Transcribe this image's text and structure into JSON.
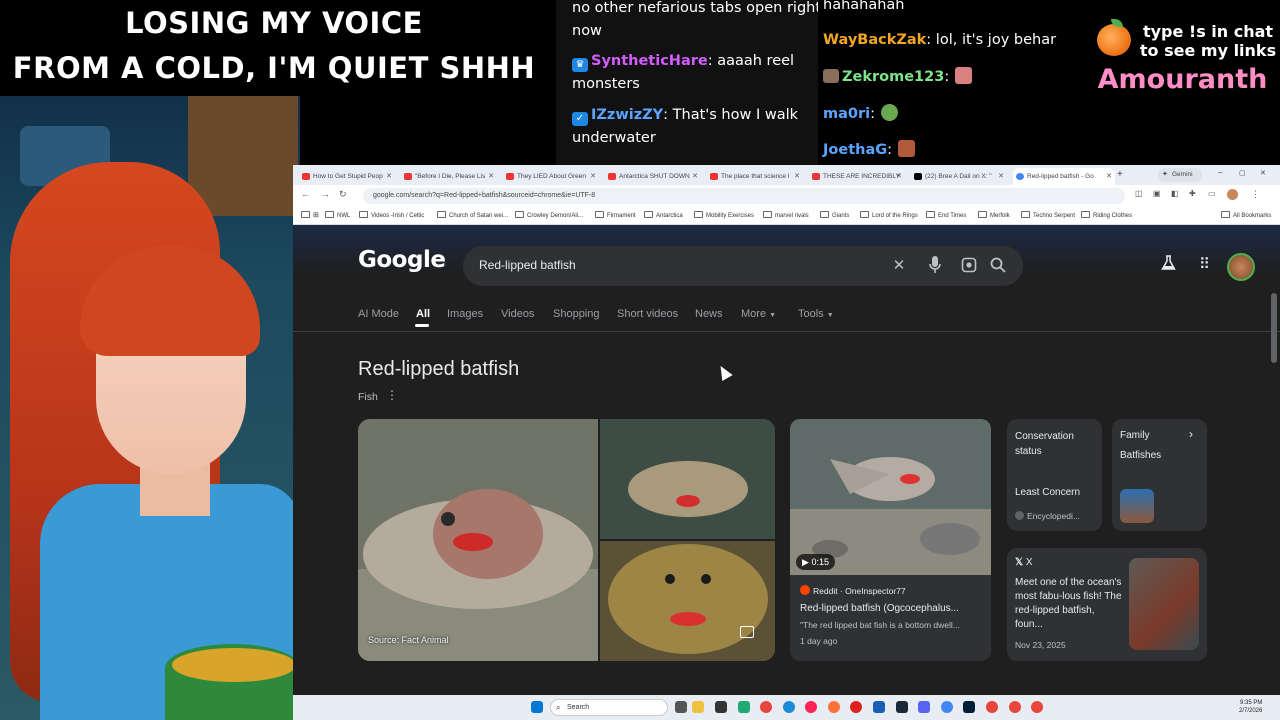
{
  "caption": {
    "line1": "LOSING MY VOICE",
    "line2": "FROM A COLD, I'M QUIET SHHH"
  },
  "chat_left": [
    {
      "user": "",
      "text": "no other nefarious tabs open right"
    },
    {
      "user": "",
      "text": "now"
    },
    {
      "user": "SyntheticHare",
      "user_color": "#d15dff",
      "text": ": aaaah reel"
    },
    {
      "user": "",
      "text": "monsters"
    },
    {
      "user": "IZzwizZY",
      "user_color": "#5aa5ff",
      "text": ": That's how I walk"
    },
    {
      "user": "",
      "text": "underwater"
    }
  ],
  "chat_right": [
    {
      "user": "",
      "text": "hahahahah"
    },
    {
      "user": "WayBackZak",
      "user_color": "#f5a623",
      "text": ": lol, it's joy behar"
    },
    {
      "user": "Zekrome123",
      "user_color": "#7ee38a",
      "text": ":"
    },
    {
      "user": "ma0ri",
      "user_color": "#5aa5ff",
      "text": ":"
    },
    {
      "user": "JoethaG",
      "user_color": "#5aa5ff",
      "text": ":"
    }
  ],
  "promo": {
    "text": "type !s in chat to see my links",
    "name": "Amouranth"
  },
  "browser": {
    "tabs": [
      "How to Get Stupid Peop",
      "\"Before I Die, Please Lis",
      "They LIED About Green",
      "Antarctica SHUT DOWN",
      "The place that science l",
      "THESE ARE INCREDIBLY",
      "(22) Bree A Dail on X: \"",
      "Red-lipped batfish - Go",
      "Gemini"
    ],
    "url": "google.com/search?q=Red-lipped+batfish&sourceid=chrome&ie=UTF-8",
    "bookmarks": [
      "NWL",
      "Videos -Irish / Celtic",
      "Church of Satan wei...",
      "Crowley Demon/Ali...",
      "Firmament",
      "Antarctica",
      "Mobility Exercises",
      "marvel rivals",
      "Giants",
      "Lord of the Rings",
      "End Times",
      "Merfolk",
      "Techno Serpent",
      "Riding Clothes"
    ],
    "all_bookmarks": "All Bookmarks"
  },
  "google": {
    "logo": "Google",
    "query": "Red-lipped batfish",
    "nav_tabs": [
      "AI Mode",
      "All",
      "Images",
      "Videos",
      "Shopping",
      "Short videos",
      "News",
      "More",
      "Tools"
    ],
    "selected_tab": "All",
    "entity_title": "Red-lipped batfish",
    "entity_subtitle": "Fish",
    "image_source": "Source: Fact Animal",
    "video": {
      "duration": "0:15",
      "source": "Reddit · OneInspector77",
      "title": "Red-lipped batfish (Ogcocephalus...",
      "snippet": "\"The red lipped bat fish is a bottom dwell...",
      "age": "1 day ago"
    },
    "conservation": {
      "label": "Conservation status",
      "value": "Least Concern",
      "source": "Encyclopedi..."
    },
    "family": {
      "label": "Family",
      "value": "Batfishes"
    },
    "x_post": {
      "platform": "X",
      "text": "Meet one of the ocean's most fabu-lous fish! The red-lipped batfish, foun...",
      "date": "Nov 23, 2025"
    }
  },
  "taskbar": {
    "search": "Search",
    "time": "9:35 PM",
    "date": "2/7/2026"
  }
}
